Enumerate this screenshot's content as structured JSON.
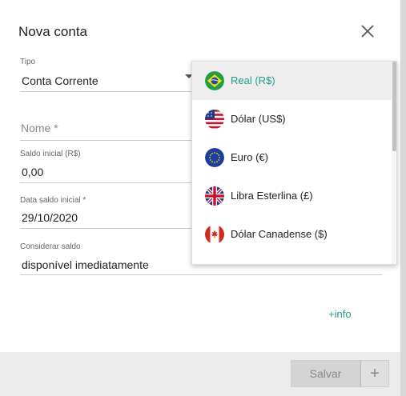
{
  "dialog": {
    "title": "Nova conta",
    "close_icon": "close-icon"
  },
  "form": {
    "tipo": {
      "label": "Tipo",
      "value": "Conta Corrente"
    },
    "nome": {
      "placeholder": "Nome *"
    },
    "saldo_inicial": {
      "label": "Saldo inicial (R$)",
      "value": "0,00"
    },
    "data_saldo": {
      "label": "Data saldo inicial *",
      "value": "29/10/2020"
    },
    "considerar_saldo": {
      "label": "Considerar saldo",
      "value": "disponível imediatamente"
    },
    "info_link": "+info"
  },
  "currency_dropdown": {
    "selected_index": 0,
    "options": [
      {
        "label": "Real (R$)",
        "icon": "brazil-flag-icon"
      },
      {
        "label": "Dólar (US$)",
        "icon": "usa-flag-icon"
      },
      {
        "label": "Euro (€)",
        "icon": "eu-flag-icon"
      },
      {
        "label": "Libra Esterlina (£)",
        "icon": "uk-flag-icon"
      },
      {
        "label": "Dólar Canadense ($)",
        "icon": "canada-flag-icon"
      }
    ]
  },
  "footer": {
    "save_label": "Salvar",
    "add_label": "+"
  },
  "colors": {
    "accent": "#1f9e8a",
    "overlay": "#7f7f7f"
  }
}
